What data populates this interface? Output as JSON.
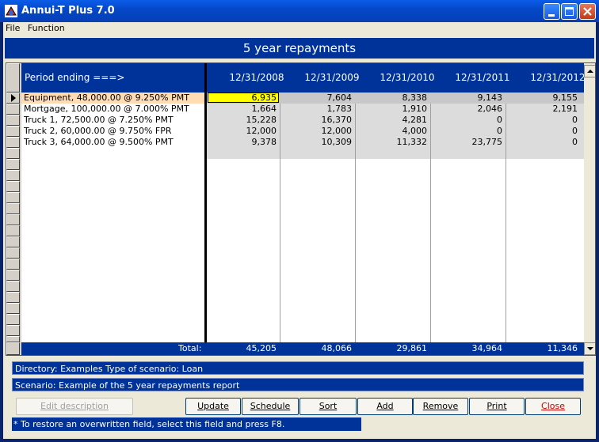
{
  "window": {
    "title": "Annui-T Plus 7.0"
  },
  "menu": [
    "File",
    "Function"
  ],
  "report_title": "5 year repayments",
  "table": {
    "period_label": "Period ending ===>",
    "dates": [
      "12/31/2008",
      "12/31/2009",
      "12/31/2010",
      "12/31/2011",
      "12/31/2012"
    ],
    "rows": [
      {
        "label": "Equipment, 48,000.00 @ 9.250% PMT",
        "values": [
          "6,935",
          "7,604",
          "8,338",
          "9,143",
          "9,155"
        ]
      },
      {
        "label": "Mortgage, 100,000.00 @ 7.000% PMT",
        "values": [
          "1,664",
          "1,783",
          "1,910",
          "2,046",
          "2,191"
        ]
      },
      {
        "label": "Truck 1, 72,500.00 @ 7.250% PMT",
        "values": [
          "15,228",
          "16,370",
          "4,281",
          "0",
          "0"
        ]
      },
      {
        "label": "Truck 2, 60,000.00 @ 9.750% FPR",
        "values": [
          "12,000",
          "12,000",
          "4,000",
          "0",
          "0"
        ]
      },
      {
        "label": "Truck 3, 64,000.00 @ 9.500% PMT",
        "values": [
          "9,378",
          "10,309",
          "11,332",
          "23,775",
          "0"
        ]
      }
    ],
    "total_label": "Total:",
    "totals": [
      "45,205",
      "48,066",
      "29,861",
      "34,964",
      "11,346"
    ]
  },
  "info": {
    "directory": "Directory: Examples    Type of scenario: Loan",
    "scenario": "Scenario: Example of the 5 year repayments report"
  },
  "buttons": {
    "edit": "Edit description",
    "update": "Update",
    "schedule": "Schedule",
    "sort": "Sort",
    "add": "Add",
    "remove": "Remove",
    "print": "Print",
    "close": "Close"
  },
  "status": "* To restore an overwritten field, select this field and press F8.",
  "colors": {
    "accent": "#003399",
    "selected_row": "#ffdcb4",
    "selected_cell": "#ffff00",
    "value_bg": "#dcdcdc"
  }
}
